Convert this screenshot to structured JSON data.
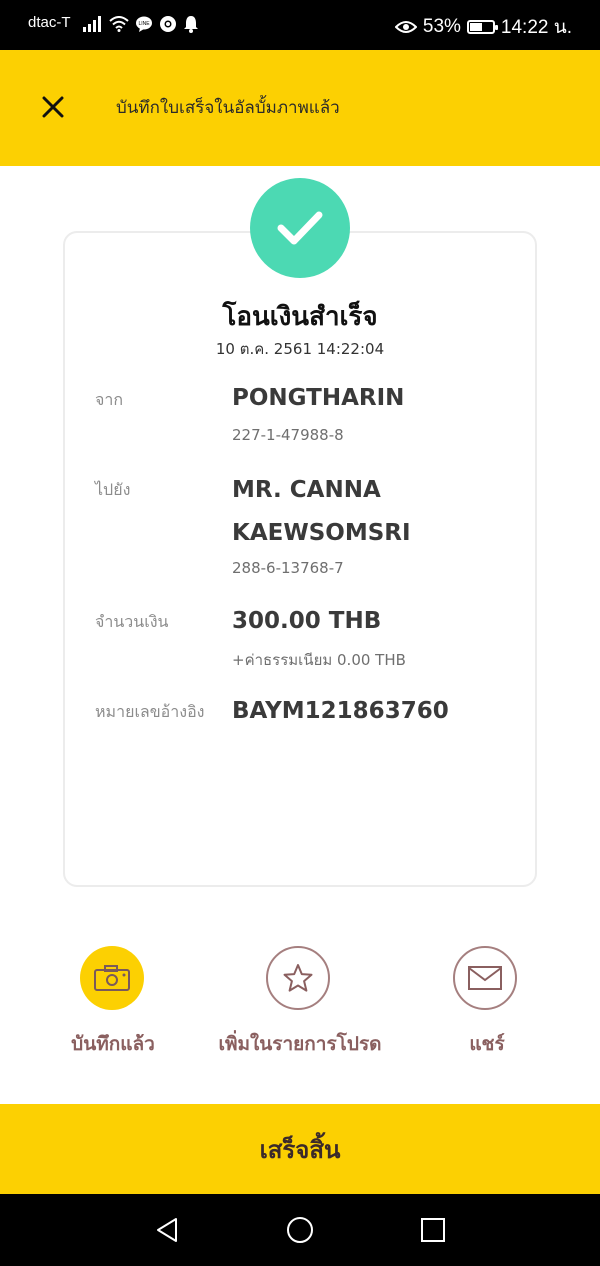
{
  "status_bar": {
    "carrier": "dtac-T",
    "battery_percent": "53%",
    "battery_level": 0.53,
    "time": "14:22 น."
  },
  "header": {
    "close_icon": "close-icon",
    "title": "บันทึกใบเสร็จในอัลบั้มภาพแล้ว"
  },
  "receipt": {
    "status_icon": "check-icon",
    "title": "โอนเงินสำเร็จ",
    "datetime": "10 ต.ค. 2561 14:22:04",
    "from": {
      "label": "จาก",
      "name": "PONGTHARIN",
      "account": "227-1-47988-8"
    },
    "to": {
      "label": "ไปยัง",
      "name_line1": "MR. CANNA",
      "name_line2": "KAEWSOMSRI",
      "account": "288-6-13768-7"
    },
    "amount": {
      "label": "จำนวนเงิน",
      "value": "300.00 THB",
      "fee": "+ค่าธรรมเนียม 0.00 THB"
    },
    "reference": {
      "label": "หมายเลขอ้างอิง",
      "value": "BAYM121863760"
    }
  },
  "actions": [
    {
      "icon": "camera-icon",
      "label": "บันทึกแล้ว"
    },
    {
      "icon": "star-icon",
      "label": "เพิ่มในรายการโปรด"
    },
    {
      "icon": "mail-icon",
      "label": "แชร์"
    }
  ],
  "done_button": "เสร็จสิ้น",
  "colors": {
    "accent_yellow": "#fcd002",
    "success_green": "#4cd9b3",
    "action_label_brown": "#8a5f5f"
  },
  "nav_icons": [
    "back-icon",
    "home-icon",
    "recents-icon"
  ]
}
